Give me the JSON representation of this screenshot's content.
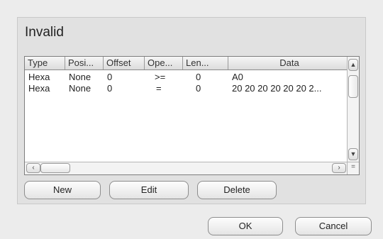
{
  "group": {
    "title": "Invalid"
  },
  "table": {
    "columns": [
      "Type",
      "Posi...",
      "Offset",
      "Ope...",
      "Len...",
      "Data"
    ],
    "rows": [
      [
        "Hexa",
        "None",
        "0",
        ">=",
        "0",
        "A0"
      ],
      [
        "Hexa",
        "None",
        "0",
        "=",
        "0",
        "20 20 20 20 20 20 2..."
      ]
    ]
  },
  "scrollbars": {
    "up_arrow": "▲",
    "down_arrow": "▼",
    "left_arrow": "‹",
    "right_arrow": "›",
    "corner": "="
  },
  "buttons": {
    "new": "New",
    "edit": "Edit",
    "delete": "Delete",
    "ok": "OK",
    "cancel": "Cancel"
  }
}
